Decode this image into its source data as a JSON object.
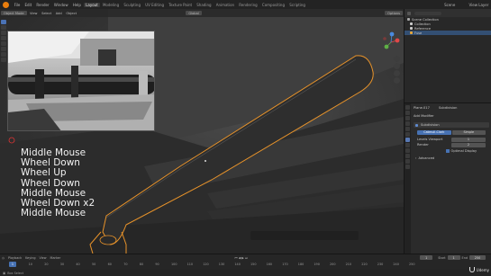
{
  "menu": {
    "items": [
      "File",
      "Edit",
      "Render",
      "Window",
      "Help"
    ],
    "workspaces": [
      "Layout",
      "Modeling",
      "Sculpting",
      "UV Editing",
      "Texture Paint",
      "Shading",
      "Animation",
      "Rendering",
      "Compositing",
      "Scripting"
    ],
    "active_workspace": "Layout",
    "scene": "Scene",
    "view_layer": "View Layer"
  },
  "viewport_header": {
    "mode": "Object Mode",
    "menus": [
      "View",
      "Select",
      "Add",
      "Object"
    ],
    "orientation": "Global",
    "options": "Options"
  },
  "overlay_keys": [
    "Middle Mouse",
    "Wheel Down",
    "Wheel Up",
    "Wheel Down",
    "Middle Mouse",
    "Wheel Down x2",
    "Middle Mouse"
  ],
  "outliner": {
    "title": "Scene Collection",
    "rows": [
      {
        "label": "Scene Collection",
        "selected": false,
        "color": "#aaaaaa"
      },
      {
        "label": "Collection",
        "selected": false,
        "color": "#cccccc"
      },
      {
        "label": "Reference",
        "selected": false,
        "color": "#cccccc"
      },
      {
        "label": "Fuse",
        "selected": true,
        "color": "#e8a73a"
      }
    ]
  },
  "properties": {
    "object_name": "Plane.017",
    "modifier_target": "Subdivision",
    "add_modifier": "Add Modifier",
    "modifier_name": "Subdivision",
    "segment_left": "Catmull-Clark",
    "segment_right": "Simple",
    "levels_viewport_label": "Levels Viewport",
    "levels_viewport_value": "1",
    "render_label": "Render",
    "render_value": "2",
    "optimal_display": "Optimal Display",
    "advanced": "Advanced"
  },
  "timeline": {
    "menus": [
      "Playback",
      "Keying",
      "View",
      "Marker"
    ],
    "current_frame": "1",
    "start_label": "Start",
    "start": "1",
    "end_label": "End",
    "end": "250",
    "ticks": [
      "0",
      "10",
      "20",
      "30",
      "40",
      "50",
      "60",
      "70",
      "80",
      "90",
      "100",
      "110",
      "120",
      "130",
      "140",
      "150",
      "160",
      "170",
      "180",
      "190",
      "200",
      "210",
      "220",
      "230",
      "240",
      "250"
    ]
  },
  "status": {
    "left": "Box Select",
    "right": "Udemy"
  },
  "colors": {
    "accent": "#4772b3",
    "selection_outline": "#e8932a",
    "viewport_bg": "#3a3a3a"
  }
}
